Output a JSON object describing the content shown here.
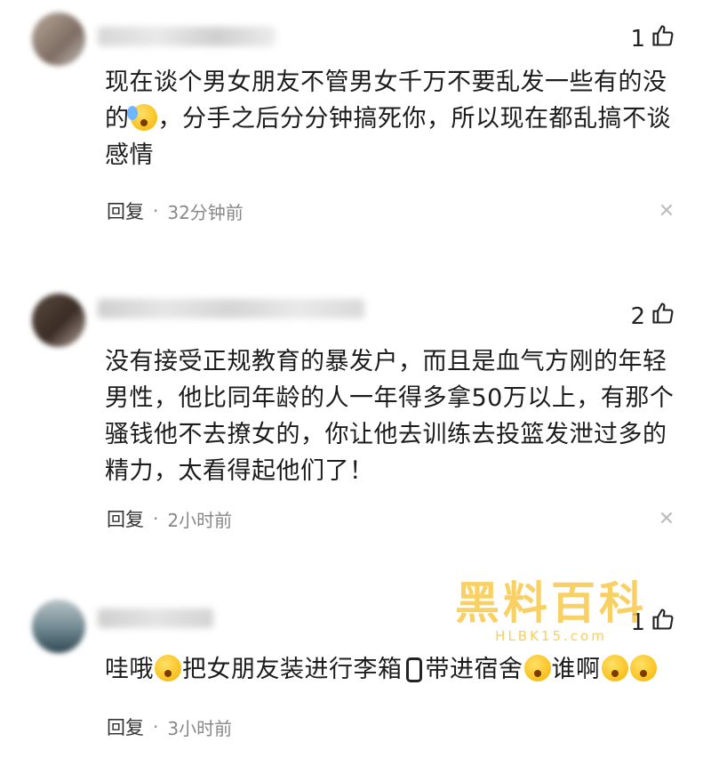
{
  "comments": [
    {
      "likes": "1",
      "text_lines": [
        "现在谈个男女朋友不管男女千万不要乱发一些有的没",
        "，分手之后分分钟搞死你，所以现在都乱搞不谈",
        "感情"
      ],
      "line2_prefix": "的",
      "reply_label": "回复",
      "separator": "·",
      "time": "32分钟前"
    },
    {
      "likes": "2",
      "text_lines": [
        "没有接受正规教育的暴发户，而且是血气方刚的年轻",
        "男性，他比同年龄的人一年得多拿50万以上，有那个",
        "骚钱他不去撩女的，你让他去训练去投篮发泄过多的",
        "精力，太看得起他们了！"
      ],
      "reply_label": "回复",
      "separator": "·",
      "time": "2小时前"
    },
    {
      "likes": "1",
      "segments": [
        "哇哦",
        "把女朋友装进行李箱",
        "带进宿舍",
        "谁啊"
      ],
      "reply_label": "回复",
      "separator": "·",
      "time": "3小时前"
    }
  ],
  "watermark": {
    "brand": "黑料百科",
    "domain": "HLBK15.com"
  },
  "colors": {
    "meta_gray": "#888888",
    "watermark": "#f7c84a"
  }
}
